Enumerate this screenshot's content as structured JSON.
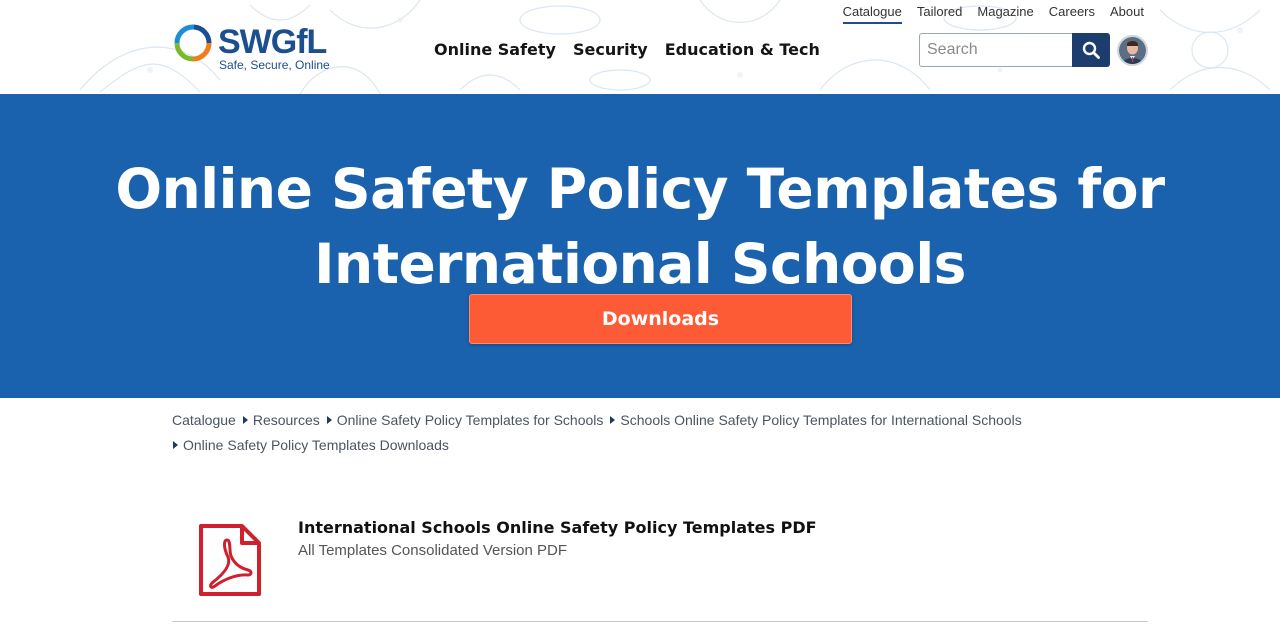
{
  "brand": {
    "name": "SWGfL",
    "tagline": "Safe, Secure, Online",
    "colors": {
      "primary": "#1b4f8f",
      "hero": "#1a62ae",
      "cta": "#fd5b35",
      "search_button": "#1c3d6e",
      "pdf_red": "#d0202e"
    }
  },
  "top_nav": {
    "items": [
      {
        "label": "Catalogue",
        "active": true
      },
      {
        "label": "Tailored"
      },
      {
        "label": "Magazine"
      },
      {
        "label": "Careers"
      },
      {
        "label": "About"
      }
    ]
  },
  "main_nav": {
    "items": [
      {
        "label": "Online Safety"
      },
      {
        "label": "Security"
      },
      {
        "label": "Education & Tech"
      }
    ]
  },
  "search": {
    "placeholder": "Search",
    "value": "",
    "icon": "search-icon"
  },
  "hero": {
    "title": "Online Safety Policy Templates for International Schools",
    "button_label": "Downloads"
  },
  "breadcrumb": {
    "items": [
      "Catalogue",
      "Resources",
      "Online Safety Policy Templates for Schools",
      "Schools Online Safety Policy Templates for International Schools",
      "Online Safety Policy Templates Downloads"
    ]
  },
  "downloads": {
    "items": [
      {
        "title": "International Schools Online Safety Policy Templates PDF",
        "subtitle": "All Templates Consolidated Version PDF",
        "icon": "pdf-icon"
      }
    ]
  }
}
